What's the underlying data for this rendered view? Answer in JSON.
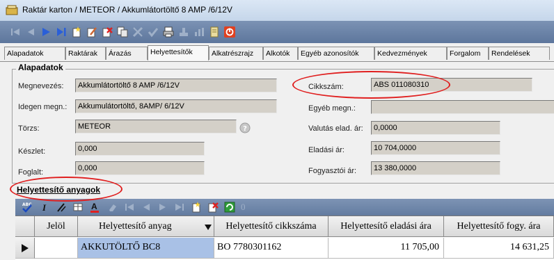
{
  "window": {
    "title": "Raktár karton / METEOR / Akkumlátortöltő 8 AMP /6/12V"
  },
  "toolbar": {
    "icons": [
      "first-record-icon",
      "prev-record-icon",
      "next-record-icon",
      "last-record-icon",
      "new-record-icon",
      "edit-record-icon",
      "delete-record-icon",
      "copy-record-icon",
      "cancel-edit-icon",
      "confirm-icon",
      "print-icon",
      "tool-icon",
      "chart-icon",
      "notes-icon",
      "close-red-icon"
    ]
  },
  "tabs": [
    "Alapadatok",
    "Raktárak",
    "Árazás",
    "Helyettesítők",
    "Alkatrészrajz",
    "Alkotók",
    "Egyéb azonosítók",
    "Kedvezmények",
    "Forgalom",
    "Rendelések"
  ],
  "active_tab": "Helyettesítők",
  "basic": {
    "section_title": "Alapadatok",
    "name_label": "Megnevezés:",
    "name_value": "Akkumlátortöltő 8 AMP /6/12V",
    "foreign_name_label": "Idegen megn.:",
    "foreign_name_value": "Akkumulátortöltő, 8AMP/ 6/12V",
    "master_label": "Törzs:",
    "master_value": "METEOR",
    "stock_label": "Készlet:",
    "stock_value": "0,000",
    "reserved_label": "Foglalt:",
    "reserved_value": "0,000",
    "article_no_label": "Cikkszám:",
    "article_no_value": "ABS 011080310",
    "other_name_label": "Egyéb megn.:",
    "other_name_value": "",
    "currency_price_label": "Valutás elad. ár:",
    "currency_price_value": "0,0000",
    "sale_price_label": "Eladási ár:",
    "sale_price_value": "10 704,0000",
    "consumer_price_label": "Fogyasztói ár:",
    "consumer_price_value": "13 380,0000"
  },
  "substitutes": {
    "section_title": "Helyettesítő anyagok",
    "grid_tools": [
      "spellcheck-icon",
      "cut-icon",
      "format-brush-icon",
      "table-icon",
      "font-color-icon",
      "eraser-icon",
      "first-icon",
      "prev-icon",
      "next-icon",
      "last-icon",
      "new-icon",
      "delete-icon",
      "refresh-icon"
    ],
    "count_label": "0",
    "columns": [
      "Jelöl",
      "Helyettesítő anyag",
      "Helyettesítő cikkszáma",
      "Helyettesítő eladási ára",
      "Helyettesítő fogy. ára"
    ],
    "rows": [
      {
        "jelol": "",
        "anyag": "AKKUTÖLTŐ BC8",
        "cikkszam": "BO 7780301162",
        "eladasi": "11 705,00",
        "fogy": "14 631,25"
      }
    ]
  },
  "colors": {
    "highlight": "#e01f1f",
    "selected_cell": "#a9c1e6",
    "toolbar": "#5d769c"
  }
}
